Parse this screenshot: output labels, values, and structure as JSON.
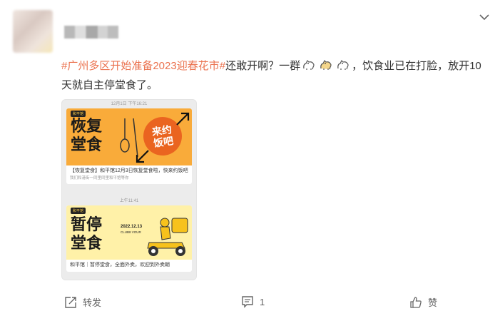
{
  "post": {
    "text_part1": "还敢开啊？一群",
    "text_part2": "，饮食业已在打脸，放开10天就自主停堂食了。",
    "hashtag": "#广州多区开始准备2023迎春花市#",
    "emoji_icons": [
      "alpaca-icon",
      "alpaca-icon",
      "alpaca-icon"
    ]
  },
  "card1": {
    "timestamp": "12月1日 下午16:21",
    "logo": "和平馆",
    "big_text_line1": "恢复",
    "big_text_line2": "堂食",
    "circle_line1": "来约",
    "circle_line2": "饭吧",
    "title": "【恢复堂食】和平馆12月3日恢复堂食啦，快来约饭吧",
    "subtitle": "我们和港街一同里同里和平馆等你"
  },
  "card2": {
    "timestamp": "上午11:41",
    "logo": "和平馆",
    "big_text_line1": "暂停",
    "big_text_line2": "堂食",
    "date_line1": "2022.12.13",
    "date_line2": "CLUB8 VOUR",
    "title": "和平馆｜暂停堂食，全面外卖，欢迎到外卖朝"
  },
  "actions": {
    "repost_label": "转发",
    "comment_count": "1",
    "like_label": "赞"
  },
  "colors": {
    "hashtag": "#eb7350",
    "accent_orange": "#ea6420"
  }
}
